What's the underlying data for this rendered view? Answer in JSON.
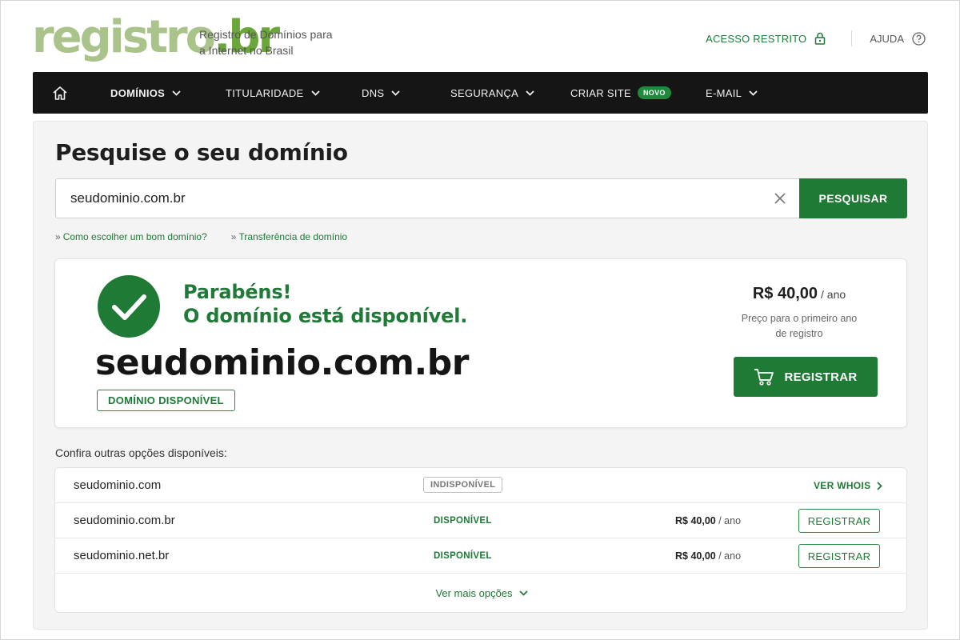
{
  "brand": {
    "logo_part1": "registro",
    "logo_part2": ".br",
    "tagline_line1": "Registro de Domínios para",
    "tagline_line2": "a Internet no Brasil",
    "colors": {
      "logo_light": "#a9c38a",
      "logo_dark": "#6aa63a",
      "accent": "#1f7a36"
    }
  },
  "top_links": {
    "acesso": "ACESSO RESTRITO",
    "ajuda": "AJUDA"
  },
  "nav": {
    "home_icon": "home-icon",
    "items": [
      {
        "label": "DOMÍNIOS",
        "active": true
      },
      {
        "label": "TITULARIDADE"
      },
      {
        "label": "DNS"
      },
      {
        "label": "SEGURANÇA"
      },
      {
        "label": "CRIAR SITE",
        "badge": "NOVO"
      },
      {
        "label": "E-MAIL"
      }
    ]
  },
  "search": {
    "title": "Pesquise o seu domínio",
    "value": "seudominio.com.br",
    "button": "PESQUISAR",
    "links": [
      "Como escolher um bom domínio?",
      "Transferência de domínio"
    ]
  },
  "result": {
    "congrats_line1": "Parabéns!",
    "congrats_line2": "O domínio está disponível.",
    "domain": "seudominio.com.br",
    "tag": "DOMÍNIO DISPONÍVEL",
    "price": "R$ 40,00",
    "per": "/ ano",
    "price_note_line1": "Preço para o primeiro ano",
    "price_note_line2": "de registro",
    "register_button": "REGISTRAR"
  },
  "others": {
    "title": "Confira outras opções disponíveis:",
    "rows": [
      {
        "name": "seudominio.com",
        "status": "INDISPONÍVEL",
        "action": "VER WHOIS"
      },
      {
        "name": "seudominio.com.br",
        "status": "DISPONÍVEL",
        "price": "R$ 40,00",
        "per": "/ ano",
        "action": "REGISTRAR"
      },
      {
        "name": "seudominio.net.br",
        "status": "DISPONÍVEL",
        "price": "R$ 40,00",
        "per": "/ ano",
        "action": "REGISTRAR"
      }
    ],
    "more": "Ver mais opções"
  }
}
